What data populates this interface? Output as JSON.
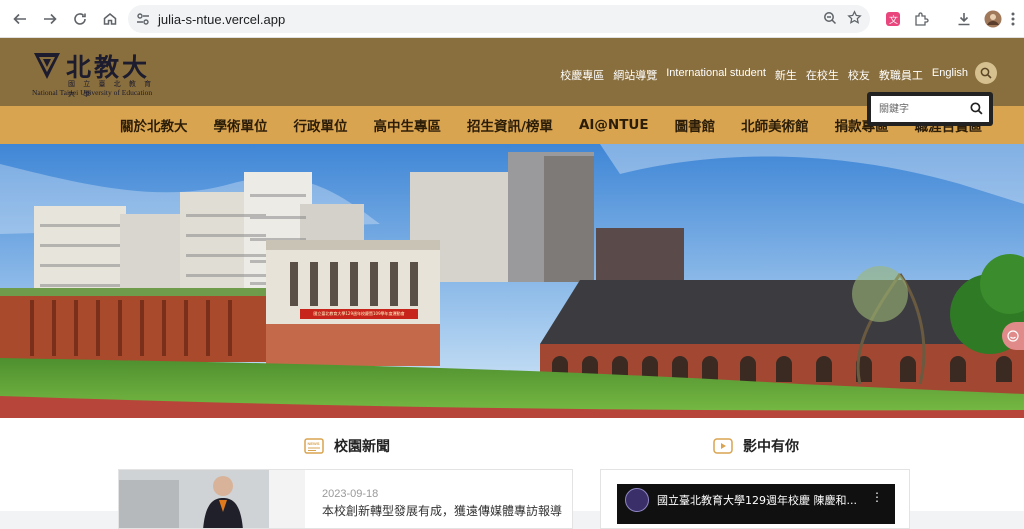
{
  "browser": {
    "url": "julia-s-ntue.vercel.app",
    "icons": [
      "back-icon",
      "forward-icon",
      "reload-icon",
      "home-icon",
      "site-settings-icon",
      "zoom-icon",
      "bookmark-star-icon",
      "extension-translate-icon",
      "extensions-puzzle-icon",
      "download-icon",
      "profile-avatar",
      "menu-kebab-icon"
    ]
  },
  "site": {
    "logo": {
      "name": "北教大",
      "sub": "國 立 臺 北 教 育 大 學",
      "eng": "National Taipei University of Education"
    },
    "toplinks": [
      "校慶專區",
      "網站導覽",
      "International student",
      "新生",
      "在校生",
      "校友",
      "教職員工",
      "English"
    ],
    "nav": [
      "關於北教大",
      "學術單位",
      "行政單位",
      "高中生專區",
      "招生資訊/榜單",
      "AI@NTUE",
      "圖書館",
      "北師美術館",
      "捐款專區",
      "職涯百寶區"
    ],
    "search_placeholder": "關鍵字",
    "banner_text": "國立臺北教育大學129週年校慶暨109學年度運動會"
  },
  "news": {
    "title": "校園新聞",
    "date": "2023-09-18",
    "headline": "本校創新轉型發展有成，獲遠傳媒體專訪報導"
  },
  "videos": {
    "title": "影中有你",
    "video_title": "國立臺北教育大學129週年校慶 陳慶和..."
  },
  "colors": {
    "header": "#8a6f3e",
    "nav": "#d9a450",
    "accent": "#d7c08f"
  }
}
